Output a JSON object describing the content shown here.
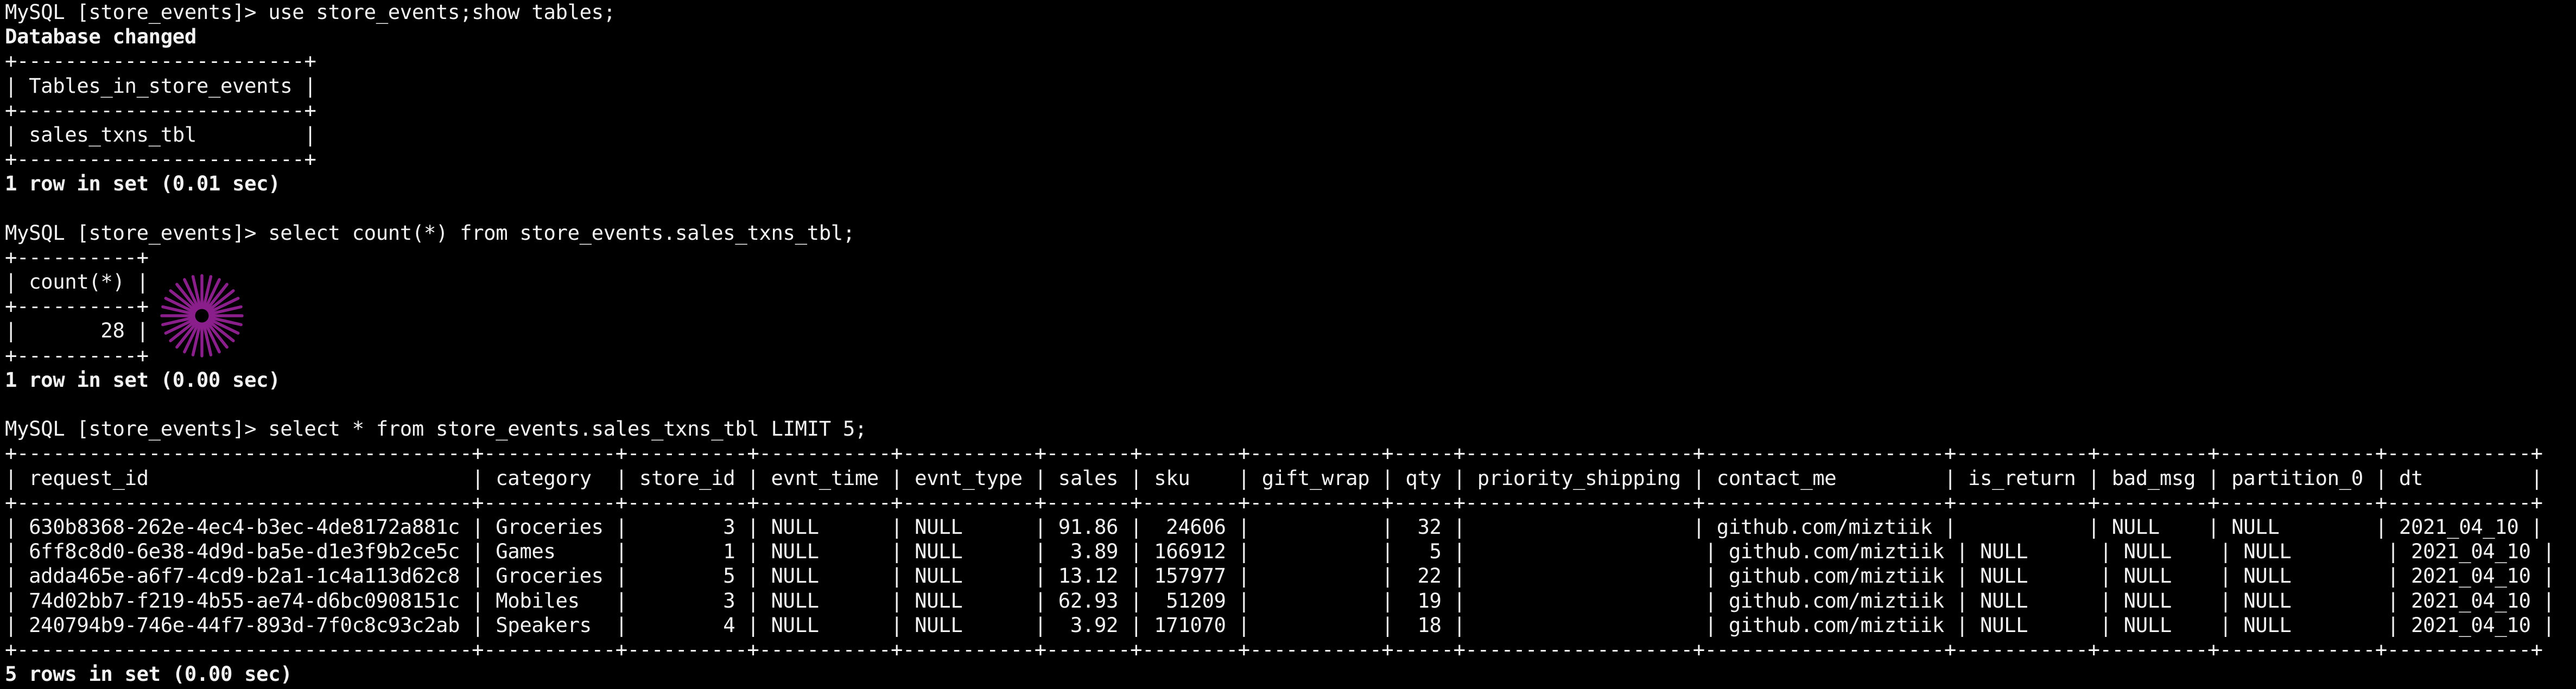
{
  "terminal": {
    "lines": [
      {
        "text": "MySQL [store_events]> use store_events;show tables;",
        "bold": false
      },
      {
        "text": "Database changed",
        "bold": true
      },
      {
        "text": "+------------------------+",
        "bold": false
      },
      {
        "text": "| Tables_in_store_events |",
        "bold": false
      },
      {
        "text": "+------------------------+",
        "bold": false
      },
      {
        "text": "| sales_txns_tbl         |",
        "bold": false
      },
      {
        "text": "+------------------------+",
        "bold": false
      },
      {
        "text": "1 row in set (0.01 sec)",
        "bold": true
      },
      {
        "text": "",
        "bold": false
      },
      {
        "text": "MySQL [store_events]> select count(*) from store_events.sales_txns_tbl;",
        "bold": false
      },
      {
        "text": "+----------+",
        "bold": false
      },
      {
        "text": "| count(*) |",
        "bold": false
      },
      {
        "text": "+----------+",
        "bold": false
      },
      {
        "text": "|       28 |",
        "bold": false
      },
      {
        "text": "+----------+",
        "bold": false
      },
      {
        "text": "1 row in set (0.00 sec)",
        "bold": true
      },
      {
        "text": "",
        "bold": false
      },
      {
        "text": "MySQL [store_events]> select * from store_events.sales_txns_tbl LIMIT 5;",
        "bold": false
      },
      {
        "text": "+--------------------------------------+-----------+----------+-----------+-----------+-------+--------+-----------+-----+-------------------+--------------------+-----------+---------+-------------+------------+",
        "bold": false
      },
      {
        "text": "| request_id                           | category  | store_id | evnt_time | evnt_type | sales | sku    | gift_wrap | qty | priority_shipping | contact_me         | is_return | bad_msg | partition_0 | dt         |",
        "bold": false
      },
      {
        "text": "+--------------------------------------+-----------+----------+-----------+-----------+-------+--------+-----------+-----+-------------------+--------------------+-----------+---------+-------------+------------+",
        "bold": false
      },
      {
        "text": "| 630b8368-262e-4ec4-b3ec-4de8172a881c | Groceries |        3 | NULL      | NULL      | 91.86 |  24606 |           |  32 |                   | github.com/miztiik |           | NULL    | NULL        | 2021_04_10 |",
        "bold": false
      },
      {
        "text": "| 6ff8c8d0-6e38-4d9d-ba5e-d1e3f9b2ce5c | Games     |        1 | NULL      | NULL      |  3.89 | 166912 |           |   5 |                    | github.com/miztiik | NULL      | NULL    | NULL        | 2021_04_10 |",
        "bold": false
      },
      {
        "text": "| adda465e-a6f7-4cd9-b2a1-1c4a113d62c8 | Groceries |        5 | NULL      | NULL      | 13.12 | 157977 |           |  22 |                    | github.com/miztiik | NULL      | NULL    | NULL        | 2021_04_10 |",
        "bold": false
      },
      {
        "text": "| 74d02bb7-f219-4b55-ae74-d6bc0908151c | Mobiles   |        3 | NULL      | NULL      | 62.93 |  51209 |           |  19 |                    | github.com/miztiik | NULL      | NULL    | NULL        | 2021_04_10 |",
        "bold": false
      },
      {
        "text": "| 240794b9-746e-44f7-893d-7f0c8c93c2ab | Speakers  |        4 | NULL      | NULL      |  3.92 | 171070 |           |  18 |                    | github.com/miztiik | NULL      | NULL    | NULL        | 2021_04_10 |",
        "bold": false
      },
      {
        "text": "+--------------------------------------+-----------+----------+-----------+-----------+-------+--------+-----------+-----+-------------------+--------------------+-----------+---------+-------------+------------+",
        "bold": false
      },
      {
        "text": "5 rows in set (0.00 sec)",
        "bold": true
      }
    ]
  },
  "colors": {
    "background": "#000000",
    "text": "#f2f2f2",
    "spinner": "#8a1f8c"
  },
  "icons": {
    "loading": "loading-spinner-icon"
  }
}
